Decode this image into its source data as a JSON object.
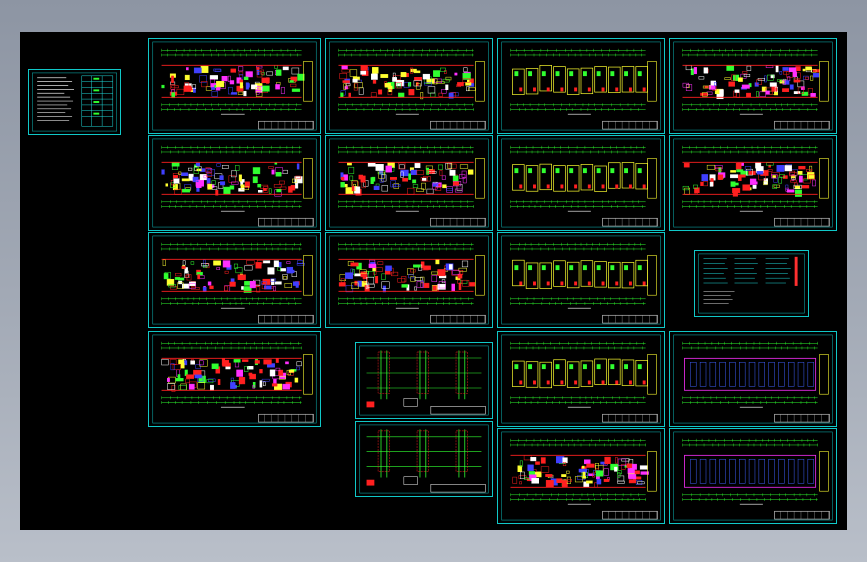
{
  "app": {
    "title": "",
    "view": "model-space"
  },
  "colors": {
    "background_outer": "#9aa1ad",
    "canvas": "#000000",
    "frame": "#10c8c8",
    "wall": "#ff2020",
    "dimension": "#30ff30",
    "fixture": "#ffff30",
    "furniture": "#4040ff",
    "highlight": "#ff30ff"
  },
  "sheets": [
    {
      "id": "notes-sheet",
      "kind": "notes"
    },
    {
      "id": "plan-r1c1",
      "kind": "plan"
    },
    {
      "id": "plan-r1c2",
      "kind": "plan"
    },
    {
      "id": "plan-r1c3",
      "kind": "plan"
    },
    {
      "id": "plan-r1c4",
      "kind": "plan"
    },
    {
      "id": "plan-r2c1",
      "kind": "plan"
    },
    {
      "id": "plan-r2c2",
      "kind": "plan"
    },
    {
      "id": "plan-r2c3",
      "kind": "plan"
    },
    {
      "id": "plan-r2c4",
      "kind": "plan"
    },
    {
      "id": "plan-r3c1",
      "kind": "plan"
    },
    {
      "id": "plan-r3c2",
      "kind": "plan"
    },
    {
      "id": "plan-r3c3",
      "kind": "plan"
    },
    {
      "id": "legend-sheet",
      "kind": "legend"
    },
    {
      "id": "plan-r4c1",
      "kind": "plan"
    },
    {
      "id": "system-r4c2a",
      "kind": "system"
    },
    {
      "id": "system-r4c2b",
      "kind": "system"
    },
    {
      "id": "plan-r4c3",
      "kind": "plan"
    },
    {
      "id": "plan-r4c4",
      "kind": "plan"
    },
    {
      "id": "plan-r5c3",
      "kind": "plan"
    },
    {
      "id": "plan-r5c4",
      "kind": "plan"
    }
  ]
}
